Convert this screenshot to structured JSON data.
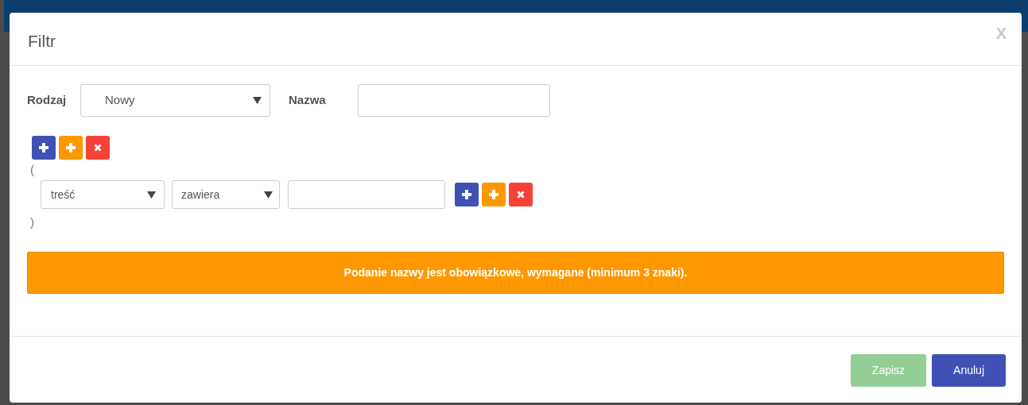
{
  "dialog": {
    "title": "Filtr",
    "close": "X"
  },
  "form": {
    "type_label": "Rodzaj",
    "type_value": "Nowy",
    "name_label": "Nazwa"
  },
  "group": {
    "open": "(",
    "close": ")",
    "conditions": [
      {
        "field": "treść",
        "operator": "zawiera"
      }
    ]
  },
  "alert": "Podanie nazwy jest obowiązkowe, wymagane (minimum 3 znaki).",
  "buttons": [
    {
      "label": "Zapisz",
      "kind": "save",
      "disabled": true
    },
    {
      "label": "Anuluj",
      "kind": "cancel",
      "disabled": false
    }
  ]
}
